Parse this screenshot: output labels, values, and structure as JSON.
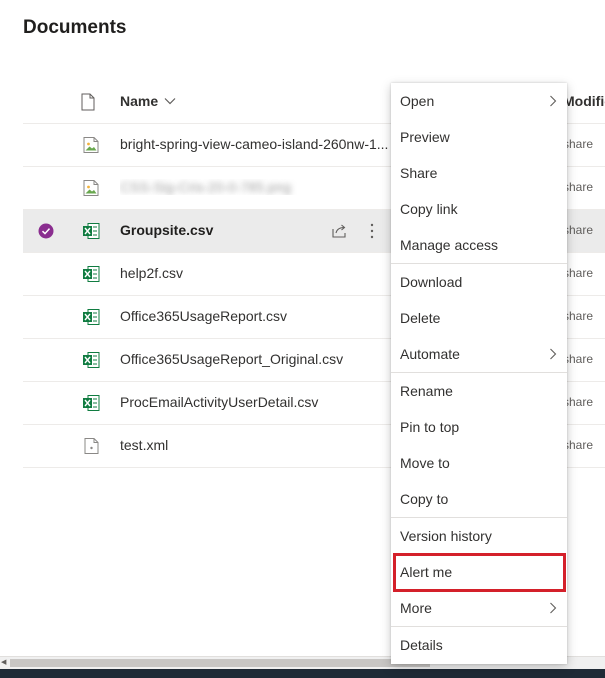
{
  "library": {
    "title": "Documents"
  },
  "header": {
    "name_label": "Name",
    "modified_label": "Modified"
  },
  "files": [
    {
      "name": "bright-spring-view-cameo-island-260nw-1...",
      "type": "image",
      "modified": "share",
      "selected": false,
      "blurred": false
    },
    {
      "name": "CSS-Sig-Cris-20-0-785.png",
      "type": "image",
      "modified": "share",
      "selected": false,
      "blurred": true
    },
    {
      "name": "Groupsite.csv",
      "type": "excel",
      "modified": "share",
      "selected": true,
      "blurred": false
    },
    {
      "name": "help2f.csv",
      "type": "excel",
      "modified": "share",
      "selected": false,
      "blurred": false
    },
    {
      "name": "Office365UsageReport.csv",
      "type": "excel",
      "modified": "share",
      "selected": false,
      "blurred": false
    },
    {
      "name": "Office365UsageReport_Original.csv",
      "type": "excel",
      "modified": "share",
      "selected": false,
      "blurred": false
    },
    {
      "name": "ProcEmailActivityUserDetail.csv",
      "type": "excel",
      "modified": "share",
      "selected": false,
      "blurred": false
    },
    {
      "name": "test.xml",
      "type": "xml",
      "modified": "share",
      "selected": false,
      "blurred": false
    }
  ],
  "context_menu": {
    "items": [
      {
        "label": "Open",
        "submenu": true
      },
      {
        "label": "Preview",
        "submenu": false
      },
      {
        "label": "Share",
        "submenu": false
      },
      {
        "label": "Copy link",
        "submenu": false
      },
      {
        "label": "Manage access",
        "submenu": false
      },
      {
        "label": "Download",
        "submenu": false
      },
      {
        "label": "Delete",
        "submenu": false
      },
      {
        "label": "Automate",
        "submenu": true
      },
      {
        "label": "Rename",
        "submenu": false
      },
      {
        "label": "Pin to top",
        "submenu": false
      },
      {
        "label": "Move to",
        "submenu": false
      },
      {
        "label": "Copy to",
        "submenu": false
      },
      {
        "label": "Version history",
        "submenu": false
      },
      {
        "label": "Alert me",
        "submenu": false
      },
      {
        "label": "More",
        "submenu": true
      },
      {
        "label": "Details",
        "submenu": false
      }
    ],
    "highlighted_item": "Alert me"
  },
  "colors": {
    "selection_check": "#8a2d8f",
    "excel_green": "#107c41",
    "highlight_border": "#d4202a"
  }
}
